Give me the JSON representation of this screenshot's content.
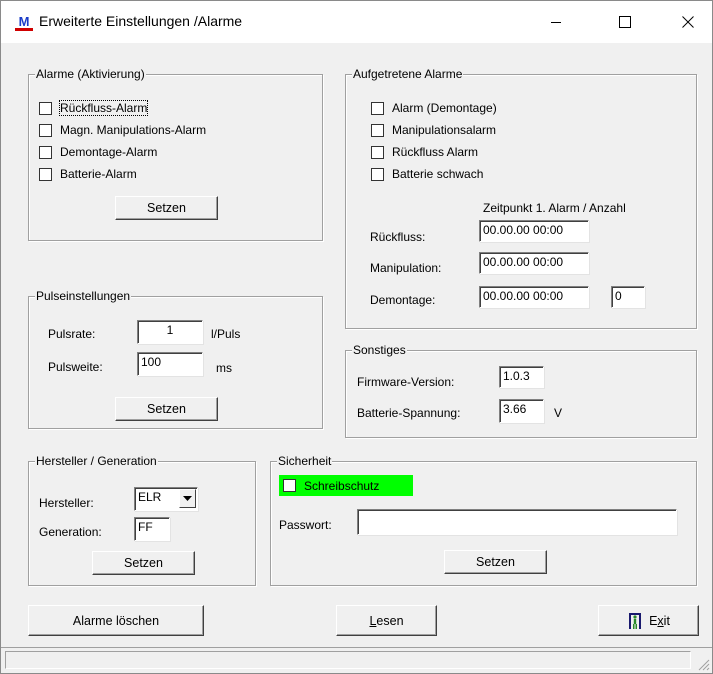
{
  "window": {
    "title": "Erweiterte Einstellungen /Alarme",
    "controls": [
      "minimize",
      "maximize",
      "close"
    ]
  },
  "alarme_aktivierung": {
    "title": "Alarme (Aktivierung)",
    "items": [
      "Rückfluss-Alarm",
      "Magn. Manipulations-Alarm",
      "Demontage-Alarm",
      "Batterie-Alarm"
    ],
    "set_label": "Setzen"
  },
  "aufgetretene_alarme": {
    "title": "Aufgetretene Alarme",
    "items": [
      "Alarm (Demontage)",
      "Manipulationsalarm",
      "Rückfluss Alarm",
      "Batterie schwach"
    ],
    "column_header": "Zeitpunkt 1. Alarm / Anzahl",
    "rows": [
      {
        "label": "Rückfluss:",
        "time": "00.00.00 00:00"
      },
      {
        "label": "Manipulation:",
        "time": "00.00.00 00:00"
      },
      {
        "label": "Demontage:",
        "time": "00.00.00 00:00",
        "count": "0"
      }
    ]
  },
  "pulseinstellungen": {
    "title": "Pulseinstellungen",
    "pulsrate_label": "Pulsrate:",
    "pulsrate_value": "1",
    "pulsrate_unit": "l/Puls",
    "pulsweite_label": "Pulsweite:",
    "pulsweite_value": "100",
    "pulsweite_unit": "ms",
    "set_label": "Setzen"
  },
  "sonstiges": {
    "title": "Sonstiges",
    "firmware_label": "Firmware-Version:",
    "firmware_value": "1.0.3",
    "battery_label": "Batterie-Spannung:",
    "battery_value": "3.66",
    "battery_unit": "V"
  },
  "hersteller": {
    "title": "Hersteller / Generation",
    "hersteller_label": "Hersteller:",
    "hersteller_value": "ELR",
    "generation_label": "Generation:",
    "generation_value": "FF",
    "set_label": "Setzen"
  },
  "sicherheit": {
    "title": "Sicherheit",
    "schreibschutz_label": "Schreibschutz",
    "schreibschutz_color": "#00ff00",
    "passwort_label": "Passwort:",
    "passwort_value": "",
    "set_label": "Setzen"
  },
  "bottom_buttons": {
    "clear_label": "Alarme löschen",
    "read_label_first": "L",
    "read_label_rest": "esen",
    "exit_label_first": "E",
    "exit_label_underline": "x",
    "exit_label_rest": "it",
    "exit_icon": "door-exit-icon"
  }
}
